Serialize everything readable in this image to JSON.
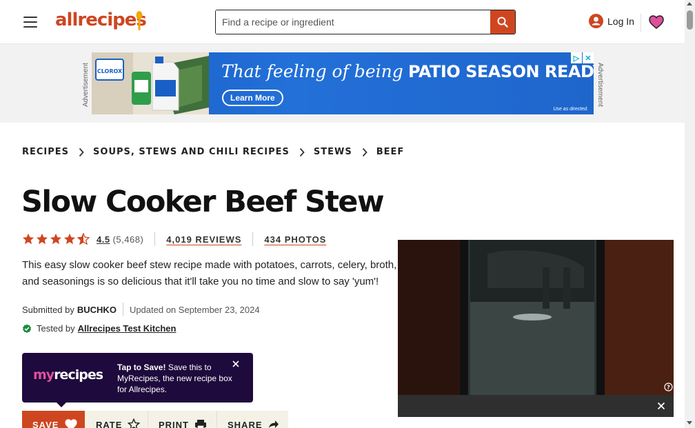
{
  "header": {
    "logo": "allrecipes",
    "search_placeholder": "Find a recipe or ingredient",
    "login_label": "Log In"
  },
  "ad": {
    "label": "Advertisement",
    "tagline_light": "That feeling of being",
    "tagline_bold": "PATIO SEASON READY",
    "cta": "Learn More",
    "fine_print": "Use as directed.",
    "brand": "CLOROX"
  },
  "breadcrumb": {
    "items": [
      "RECIPES",
      "SOUPS, STEWS AND CHILI RECIPES",
      "STEWS",
      "BEEF"
    ]
  },
  "recipe": {
    "title": "Slow Cooker Beef Stew",
    "rating": "4.5",
    "rating_value": 4.5,
    "rating_count": "(5,468)",
    "reviews": "4,019 REVIEWS",
    "photos": "434 PHOTOS",
    "description": "This easy slow cooker beef stew recipe made with potatoes, carrots, celery, broth, and seasonings is so delicious that it'll take you no time and slow to say 'yum'!",
    "submitted_prefix": "Submitted by",
    "author": "BUCHKO",
    "updated": "Updated on September 23, 2024",
    "tested_prefix": "Tested by",
    "tested_by": "Allrecipes Test Kitchen"
  },
  "myrecipes": {
    "logo_my": "my",
    "logo_recipes": "recipes",
    "headline": "Tap to Save!",
    "body": "Save this to MyRecipes, the new recipe box for Allrecipes."
  },
  "actions": {
    "save": "SAVE",
    "rate": "RATE",
    "print": "PRINT",
    "share": "SHARE"
  },
  "colors": {
    "brand": "#ce4620",
    "heart": "#e04f9c",
    "myrecipes_bg": "#1e0a3c"
  }
}
